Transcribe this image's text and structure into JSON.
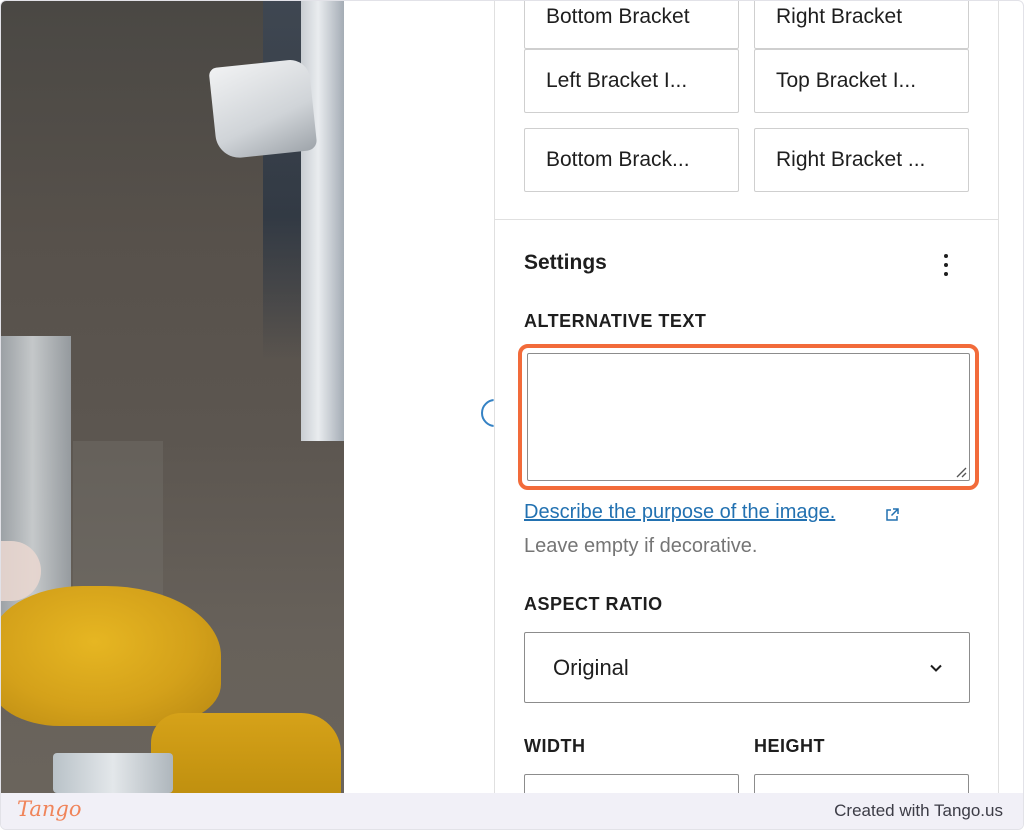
{
  "block_styles": {
    "row0": [
      "Bottom Bracket",
      "Right Bracket"
    ],
    "row1": [
      "Left Bracket I...",
      "Top Bracket I..."
    ],
    "row2": [
      "Bottom Brack...",
      "Right Bracket ..."
    ]
  },
  "settings": {
    "title": "Settings",
    "more_icon": "kebab-menu-icon",
    "alt_text": {
      "label": "ALTERNATIVE TEXT",
      "value": "",
      "link_text": "Describe the purpose of the image.",
      "link_icon": "external-link-icon",
      "hint": "Leave empty if decorative."
    },
    "aspect_ratio": {
      "label": "ASPECT RATIO",
      "selected": "Original",
      "icon": "chevron-down-icon"
    },
    "width_label": "WIDTH",
    "height_label": "HEIGHT"
  },
  "colors": {
    "highlight": "#f26b3a",
    "link": "#2271b1",
    "border": "#8c8c8c"
  },
  "footer": {
    "logo": "Tango",
    "credit": "Created with Tango.us"
  }
}
